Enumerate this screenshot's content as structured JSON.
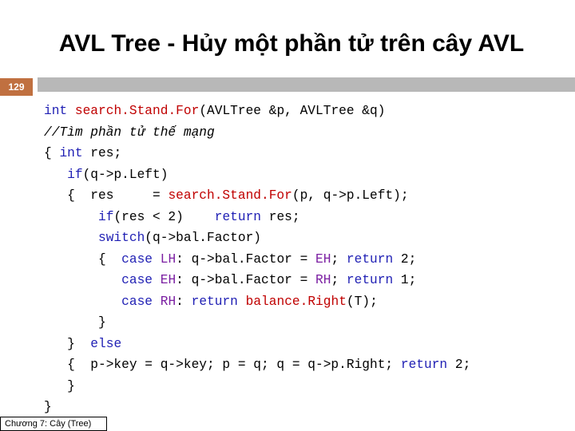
{
  "slide": {
    "title": "AVL Tree - Hủy một phần tử trên cây AVL",
    "number": "129",
    "footer": "Chương 7: Cây (Tree)"
  },
  "code": {
    "l1": {
      "kw1": "int",
      "fn": "search.Stand.For",
      "rest": "(AVLTree &p, AVLTree &q)"
    },
    "l2": {
      "comment": "//Tìm phần tử thế mạng"
    },
    "l3": {
      "a": "{ ",
      "kw": "int",
      "b": " res;"
    },
    "l4": {
      "indent": "   ",
      "kw": "if",
      "b": "(q->p.Left)"
    },
    "l5": {
      "a": "   {  res     = ",
      "fn": "search.Stand.For",
      "b": "(p, q->p.Left);"
    },
    "l6": {
      "indent": "       ",
      "kw1": "if",
      "b": "(res < 2)    ",
      "kw2": "return",
      "c": " res;"
    },
    "l7": {
      "indent": "       ",
      "kw": "switch",
      "b": "(q->bal.Factor)"
    },
    "l8": {
      "a": "       {  ",
      "kw1": "case",
      "sp": " ",
      "cn1": "LH",
      "b": ": q->bal.Factor = ",
      "cn2": "EH",
      "c": "; ",
      "kw2": "return",
      "d": " 2;"
    },
    "l9": {
      "indent": "          ",
      "kw1": "case",
      "sp": " ",
      "cn1": "EH",
      "b": ": q->bal.Factor = ",
      "cn2": "RH",
      "c": "; ",
      "kw2": "return",
      "d": " 1;"
    },
    "l10": {
      "indent": "          ",
      "kw1": "case",
      "sp": " ",
      "cn1": "RH",
      "b": ": ",
      "kw2": "return",
      "sp2": " ",
      "fn": "balance.Right",
      "c": "(T);"
    },
    "l11": {
      "text": "       }"
    },
    "l12": {
      "a": "   }  ",
      "kw": "else"
    },
    "l13": {
      "a": "   {  p->key = q->key; p = q; q = q->p.Right; ",
      "kw": "return",
      "b": " 2;"
    },
    "l14": {
      "text": "   }"
    },
    "l15": {
      "text": "}"
    }
  }
}
